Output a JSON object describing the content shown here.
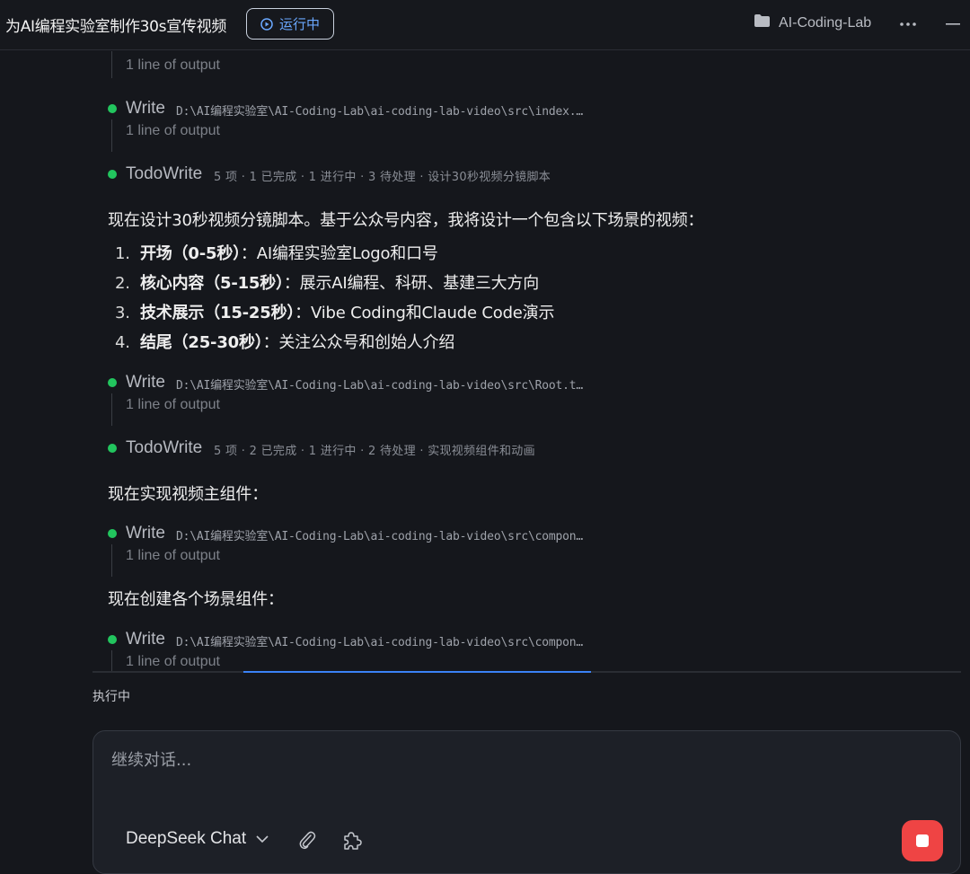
{
  "header": {
    "title": "为AI编程实验室制作30s宣传视频",
    "status": "运行中",
    "project": "AI-Coding-Lab"
  },
  "log": {
    "top_output": "1 line of output",
    "entries": [
      {
        "tool": "Write",
        "path": "D:\\AI编程实验室\\AI-Coding-Lab\\ai-coding-lab-video\\src\\index.…",
        "output": "1 line of output"
      },
      {
        "tool": "TodoWrite",
        "meta": "5 项 · 1 已完成 · 1 进行中 · 3 待处理 · 设计30秒视频分镜脚本"
      },
      {
        "tool": "Write",
        "path": "D:\\AI编程实验室\\AI-Coding-Lab\\ai-coding-lab-video\\src\\Root.t…",
        "output": "1 line of output"
      },
      {
        "tool": "TodoWrite",
        "meta": "5 项 · 2 已完成 · 1 进行中 · 2 待处理 · 实现视频组件和动画"
      },
      {
        "tool": "Write",
        "path": "D:\\AI编程实验室\\AI-Coding-Lab\\ai-coding-lab-video\\src\\compon…",
        "output": "1 line of output"
      },
      {
        "tool": "Write",
        "path": "D:\\AI编程实验室\\AI-Coding-Lab\\ai-coding-lab-video\\src\\compon…",
        "output": "1 line of output"
      }
    ],
    "para1": "现在设计30秒视频分镜脚本。基于公众号内容，我将设计一个包含以下场景的视频：",
    "scenes": [
      {
        "num": "1.",
        "title": "开场（0-5秒）",
        "desc": "：AI编程实验室Logo和口号"
      },
      {
        "num": "2.",
        "title": "核心内容（5-15秒）",
        "desc": "：展示AI编程、科研、基建三大方向"
      },
      {
        "num": "3.",
        "title": "技术展示（15-25秒）",
        "desc": "：Vibe Coding和Claude Code演示"
      },
      {
        "num": "4.",
        "title": "结尾（25-30秒）",
        "desc": "：关注公众号和创始人介绍"
      }
    ],
    "para2": "现在实现视频主组件：",
    "para3": "现在创建各个场景组件："
  },
  "status_text": "执行中",
  "progress": 0.4,
  "input": {
    "placeholder": "继续对话...",
    "model": "DeepSeek Chat"
  },
  "icons": {
    "status": "play-circle-icon",
    "project": "folder-icon",
    "more": "more-horizontal-icon",
    "minimize": "minimize-icon",
    "model_dropdown": "chevron-down-icon",
    "attach": "paperclip-icon",
    "plugin": "puzzle-icon",
    "stop": "stop-icon"
  },
  "colors": {
    "accent": "#3b82f6",
    "success_dot": "#22c55e",
    "stop": "#ef4444"
  }
}
